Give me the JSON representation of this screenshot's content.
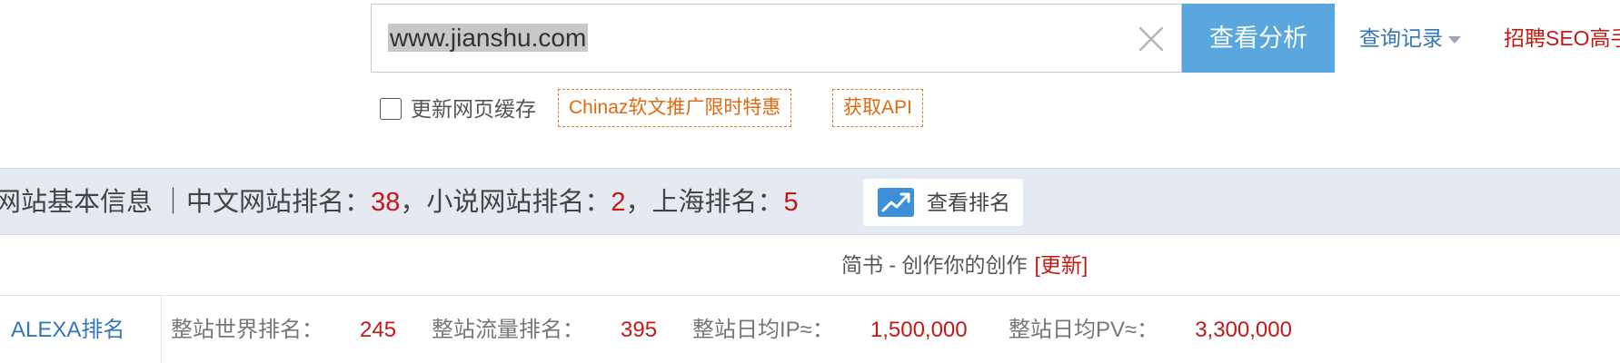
{
  "search": {
    "value": "www.jianshu.com",
    "analyze_label": "查看分析"
  },
  "header_links": {
    "history_label": "查询记录",
    "recruit_label": "招聘SEO高手"
  },
  "options": {
    "cache_label": "更新网页缓存",
    "promo_chinaz": "Chinaz软文推广限时特惠",
    "promo_api": "获取API"
  },
  "info_bar": {
    "prefix": "网站基本信息 ｜中文网站排名：",
    "rank_cn": "38",
    "sep1": "，小说网站排名：",
    "rank_novel": "2",
    "sep2": "，上海排名：",
    "rank_shanghai": "5",
    "view_rank_label": "查看排名"
  },
  "site": {
    "title": "简书 - 创作你的创作",
    "update_label": "[更新]"
  },
  "alexa": {
    "label": "ALEXA排名",
    "world_rank_label": "整站世界排名：",
    "world_rank": "245",
    "traffic_rank_label": "整站流量排名：",
    "traffic_rank": "395",
    "daily_ip_label": "整站日均IP≈：",
    "daily_ip": "1,500,000",
    "daily_pv_label": "整站日均PV≈：",
    "daily_pv": "3,300,000"
  },
  "colors": {
    "accent_blue": "#5aa7e0",
    "link_blue": "#3478b8",
    "highlight_red": "#c41a16",
    "promo_orange": "#e06a10",
    "info_bar_bg": "#e5e9f2"
  },
  "icons": {
    "clear": "close-icon",
    "history_caret": "caret-down-icon",
    "view_rank": "trend-chart-icon"
  }
}
